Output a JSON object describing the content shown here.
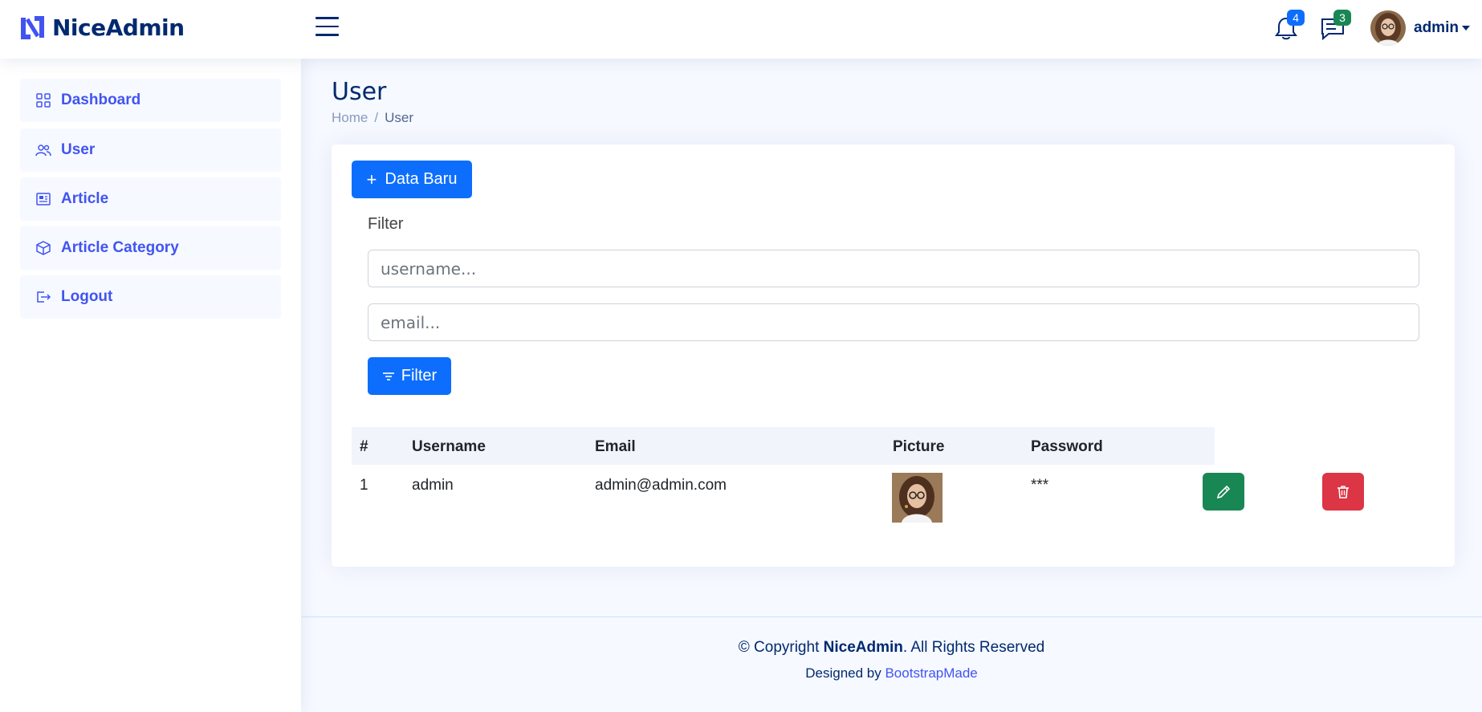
{
  "header": {
    "brand": "NiceAdmin",
    "notifications_count": "4",
    "messages_count": "3",
    "profile_name": "admin",
    "colors": {
      "notif_badge": "#0d6efd",
      "msg_badge": "#198754"
    }
  },
  "sidebar": {
    "items": [
      {
        "label": "Dashboard",
        "icon": "grid-icon"
      },
      {
        "label": "User",
        "icon": "people-icon"
      },
      {
        "label": "Article",
        "icon": "newspaper-icon"
      },
      {
        "label": "Article Category",
        "icon": "box-icon"
      },
      {
        "label": "Logout",
        "icon": "logout-icon"
      }
    ]
  },
  "page": {
    "title": "User",
    "breadcrumb": {
      "home": "Home",
      "sep": "/",
      "current": "User"
    }
  },
  "card": {
    "new_button": "Data Baru",
    "filter_label": "Filter",
    "username_placeholder": "username...",
    "email_placeholder": "email...",
    "filter_button": "Filter"
  },
  "table": {
    "headers": [
      "#",
      "Username",
      "Email",
      "Picture",
      "Password"
    ],
    "rows": [
      {
        "no": "1",
        "username": "admin",
        "email": "admin@admin.com",
        "password": "***"
      }
    ]
  },
  "footer": {
    "copyright_prefix": "© Copyright ",
    "copyright_brand": "NiceAdmin",
    "copyright_suffix": ". All Rights Reserved",
    "designed_by": "Designed by ",
    "designer": "BootstrapMade"
  }
}
